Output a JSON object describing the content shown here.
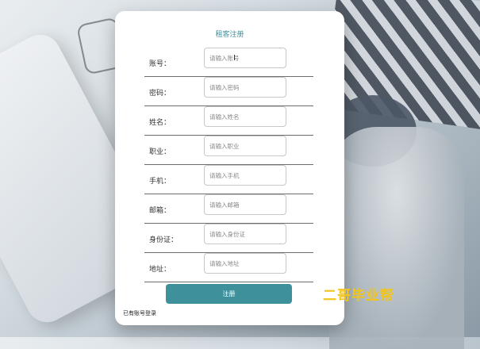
{
  "form": {
    "title": "租客注册",
    "fields": [
      {
        "label": "账号：",
        "placeholder": "请输入账号"
      },
      {
        "label": "密码：",
        "placeholder": "请输入密码"
      },
      {
        "label": "姓名：",
        "placeholder": "请输入姓名"
      },
      {
        "label": "职业：",
        "placeholder": "请输入职业"
      },
      {
        "label": "手机：",
        "placeholder": "请输入手机"
      },
      {
        "label": "邮箱：",
        "placeholder": "请输入邮箱"
      },
      {
        "label": "身份证：",
        "placeholder": "请输入身份证"
      },
      {
        "label": "地址：",
        "placeholder": "请输入地址"
      }
    ],
    "submit_label": "注册",
    "login_link": "已有账号登录"
  },
  "watermark": "二哥毕业帮",
  "colors": {
    "accent": "#3e909a",
    "title": "#3a8f9c",
    "watermark": "#f3c41a"
  },
  "icons": {
    "cursor": "text-cursor-icon"
  }
}
